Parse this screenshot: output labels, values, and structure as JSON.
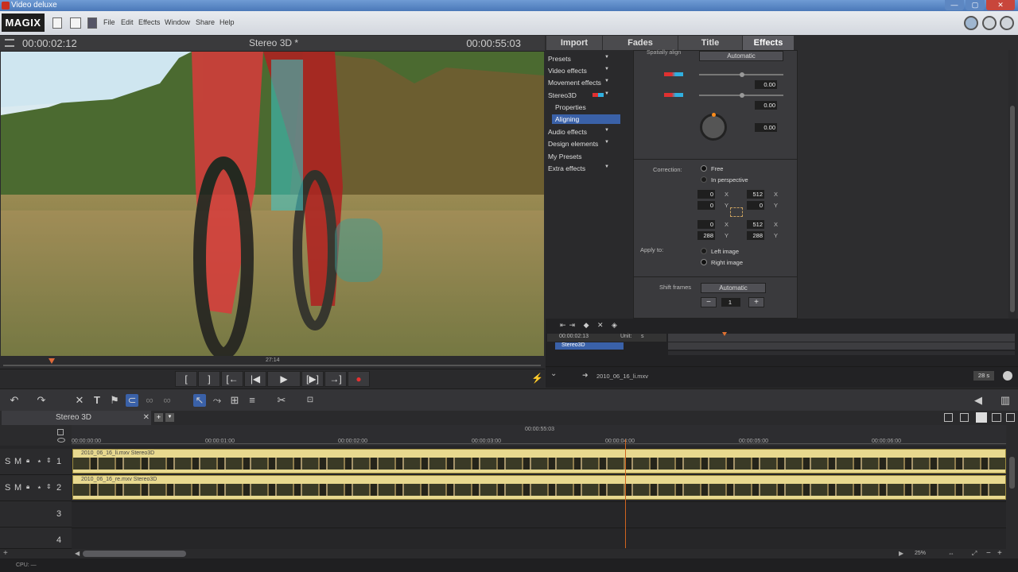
{
  "window": {
    "title": "Video deluxe"
  },
  "menubar": {
    "logo": "MAGIX",
    "items": [
      "File",
      "Edit",
      "Effects",
      "Window",
      "Share",
      "Help"
    ]
  },
  "preview": {
    "timecode_left": "00:00:02:12",
    "title": "Stereo 3D *",
    "timecode_right": "00:00:55:03",
    "scrub_time": "27:14"
  },
  "transport": {
    "buttons": [
      "[",
      "]",
      "[←",
      "|◀",
      "▶",
      "[▶]",
      "→]",
      "●"
    ]
  },
  "rightpanel": {
    "tabs": [
      "Import",
      "Fades",
      "Title",
      "Effects"
    ],
    "tree": [
      {
        "label": "Presets",
        "arrow": true
      },
      {
        "label": "Video effects",
        "arrow": true
      },
      {
        "label": "Movement effects",
        "arrow": true
      },
      {
        "label": "Stereo3D",
        "arrow": true
      },
      {
        "label": "Properties",
        "sub": true
      },
      {
        "label": "Aligning",
        "sub": true,
        "selected": true
      },
      {
        "label": "Audio effects",
        "arrow": true
      },
      {
        "label": "Design elements",
        "arrow": true
      },
      {
        "label": "My Presets"
      },
      {
        "label": "Extra effects",
        "arrow": true
      }
    ],
    "fx": {
      "spatially_align": "Spatially align",
      "auto_btn": "Automatic",
      "val1": "0.00",
      "val2": "0.00",
      "val3": "0.00",
      "correction_label": "Correction:",
      "correction_opts": [
        "Free",
        "In perspective"
      ],
      "tl_x": "0",
      "tl_y": "0",
      "tr_x": "512",
      "tr_y": "0",
      "bl_x": "0",
      "bl_y": "288",
      "br_x": "512",
      "br_y": "288",
      "axis_x": "X",
      "axis_y": "Y",
      "apply_label": "Apply to:",
      "apply_opts": [
        "Left image",
        "Right image"
      ],
      "shift_label": "Shift frames",
      "shift_btn": "Automatic",
      "shift_val": "1",
      "minus": "−",
      "plus": "+"
    },
    "keyframe": {
      "time": "00:00:02:13",
      "unit_label": "Unit:",
      "unit_value": "s",
      "track": "Stereo3D"
    },
    "bottom": {
      "file": "2010_06_16_li.mxv",
      "zoom": "28 s"
    }
  },
  "timeline": {
    "tab": "Stereo 3D",
    "ruler_top": "00:00:55:03",
    "ruler": [
      "00:00:00:00",
      "00:00:01:00",
      "00:00:02:00",
      "00:00:03:00",
      "00:00:04:00",
      "00:00:05:00",
      "00:00:06:00"
    ],
    "tracks": [
      {
        "num": "1",
        "clip": "2010_06_16_li.mxv  Stereo3D",
        "solo": "S",
        "mute": "M"
      },
      {
        "num": "2",
        "clip": "2010_06_16_re.mxv  Stereo3D",
        "solo": "S",
        "mute": "M"
      },
      {
        "num": "3"
      },
      {
        "num": "4"
      }
    ],
    "zoom": "25%"
  },
  "status": {
    "cpu": "CPU: —"
  }
}
